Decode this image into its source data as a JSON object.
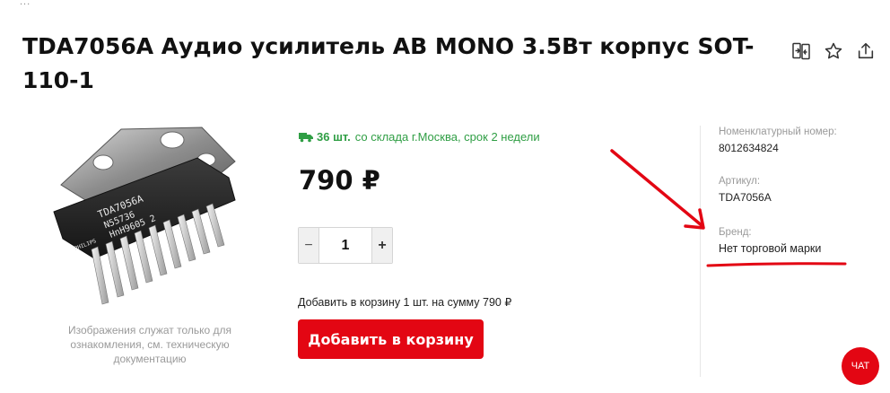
{
  "breadcrumb": {
    "ellipsis": "..."
  },
  "product": {
    "title": "TDA7056A Аудио усилитель АВ MONO 3.5Вт корпус SOT-110-1",
    "chip_marking": {
      "line1": "TDA7056A",
      "line2": "N55736",
      "line3": "HnH9605 2",
      "logo": "PHILIPS"
    },
    "image_caption": "Изображения служат только для ознакомления, см. техническую документацию"
  },
  "actions": {
    "icons": [
      "compare-icon",
      "star-icon",
      "share-icon"
    ]
  },
  "availability": {
    "quantity": "36 шт.",
    "text": "со склада г.Москва, срок 2 недели",
    "color": "#2f9e44"
  },
  "price": "790 ₽",
  "cart": {
    "quantity": "1",
    "minus": "−",
    "plus": "+",
    "summary": "Добавить в корзину 1 шт. на сумму 790 ₽",
    "add_button": "Добавить в корзину"
  },
  "specs": {
    "nomenclature_label": "Номенклатурный номер:",
    "nomenclature_value": "8012634824",
    "article_label": "Артикул:",
    "article_value": "TDA7056A",
    "brand_label": "Бренд:",
    "brand_value": "Нет торговой марки"
  },
  "chat": "ЧАТ",
  "colors": {
    "accent": "#e30613",
    "stock": "#2f9e44",
    "muted": "#9a9a9a"
  }
}
